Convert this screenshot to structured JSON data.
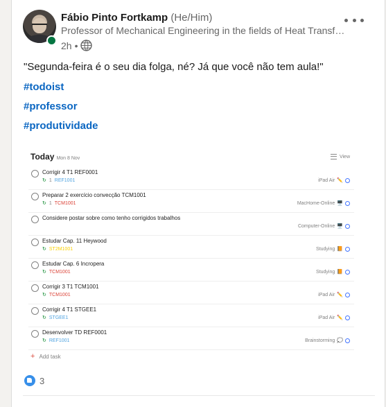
{
  "post": {
    "author_name": "Fábio Pinto Fortkamp",
    "pronouns": "(He/Him)",
    "headline": "Professor of Mechanical Engineering in the fields of Heat Transfer and Thermodynamics",
    "time": "2h",
    "separator": "•",
    "visibility_icon": "globe-icon",
    "text": "\"Segunda-feira é o seu dia folga, né? Já que você não tem aula!\"",
    "hashtags": [
      "#todoist",
      "#professor",
      "#produtividade"
    ],
    "reaction_count": "3"
  },
  "screenshot": {
    "title": "Today",
    "date": "Mon 8 Nov",
    "view_label": "View",
    "add_task_label": "Add task",
    "tasks": [
      {
        "title": "Corrigir 4 T1 REF0001",
        "comments": "1",
        "project": "REF1001",
        "project_color": "#4fa3e0",
        "label": "iPad Air",
        "label_emoji": "✏️"
      },
      {
        "title": "Preparar 2 exercício convecção TCM1001",
        "comments": "1",
        "project": "TCM1001",
        "project_color": "#db4035",
        "label": "MacHome-Online",
        "label_emoji": "🖥️"
      },
      {
        "title": "Considere postar sobre como tenho corrigidos trabalhos",
        "comments": "",
        "project": "",
        "project_color": "#808080",
        "label": "Computer-Online",
        "label_emoji": "🖥️"
      },
      {
        "title": "Estudar Cap. 11 Heywood",
        "comments": "",
        "project": "ST2M1001",
        "project_color": "#fad000",
        "label": "Studying",
        "label_emoji": "📙"
      },
      {
        "title": "Estudar Cap. 6 Incropera",
        "comments": "",
        "project": "TCM1001",
        "project_color": "#db4035",
        "label": "Studying",
        "label_emoji": "📙"
      },
      {
        "title": "Corrigir 3 T1 TCM1001",
        "comments": "",
        "project": "TCM1001",
        "project_color": "#db4035",
        "label": "iPad Air",
        "label_emoji": "✏️"
      },
      {
        "title": "Corrigir 4 T1 STGEE1",
        "comments": "",
        "project": "STGEE1",
        "project_color": "#4fa3e0",
        "label": "iPad Air",
        "label_emoji": "✏️"
      },
      {
        "title": "Desenvolver TD REF0001",
        "comments": "",
        "project": "REF1001",
        "project_color": "#4fa3e0",
        "label": "Brainstorming",
        "label_emoji": "💭"
      }
    ]
  }
}
